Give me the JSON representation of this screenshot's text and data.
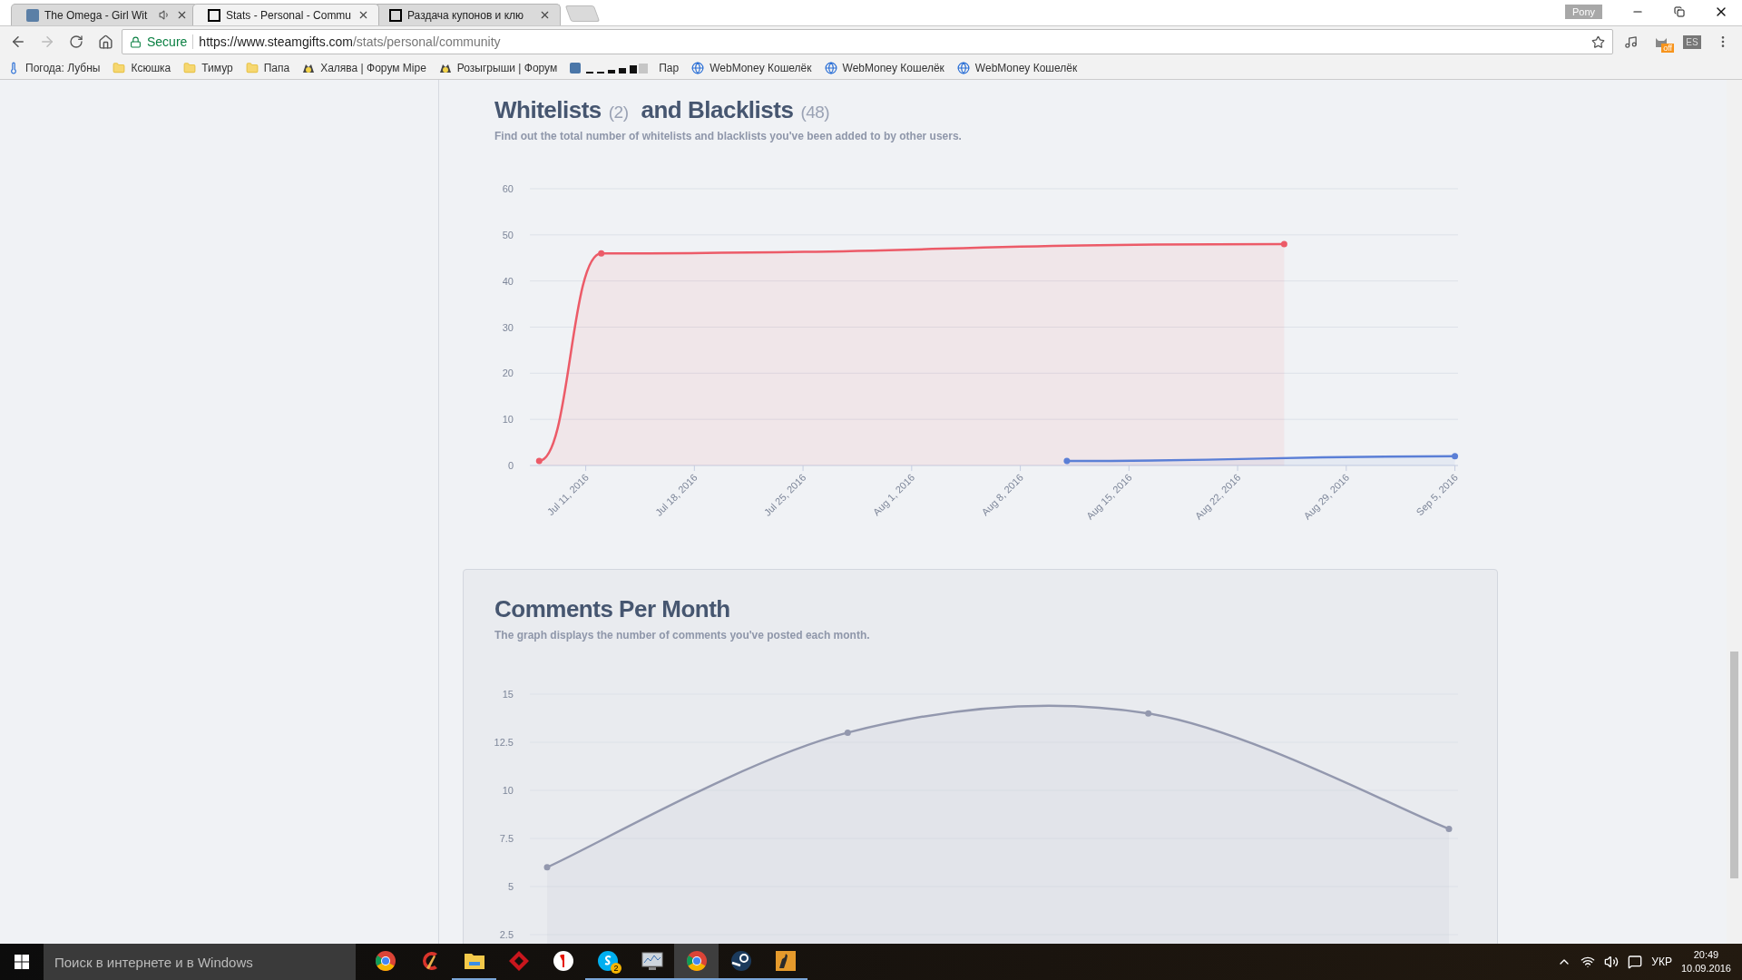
{
  "window": {
    "profile": "Pony"
  },
  "tabs": [
    {
      "title": "The Omega - Girl Wit",
      "selected": false,
      "audio": true
    },
    {
      "title": "Stats - Personal - Commu",
      "selected": true,
      "audio": false
    },
    {
      "title": "Раздача купонов и клю",
      "selected": false,
      "audio": false
    }
  ],
  "nav_buttons": [
    {
      "kind": "back",
      "disabled": false
    },
    {
      "kind": "forward",
      "disabled": true
    },
    {
      "kind": "reload",
      "disabled": false
    },
    {
      "kind": "home",
      "disabled": false
    }
  ],
  "address": {
    "secure_label": "Secure",
    "host": "https://www.steamgifts.com",
    "path": "/stats/personal/community"
  },
  "extensions": [
    {
      "kind": "clef"
    },
    {
      "kind": "cat",
      "badge": "off"
    },
    {
      "kind": "box",
      "label": "ES"
    }
  ],
  "bookmarks": [
    {
      "kind": "thermometer",
      "label": "Погода: Лубны"
    },
    {
      "kind": "folder",
      "label": "Ксюшка"
    },
    {
      "kind": "folder",
      "label": "Тимур"
    },
    {
      "kind": "folder",
      "label": "Папа"
    },
    {
      "kind": "mascot",
      "label": "Халява | Форум Mipe"
    },
    {
      "kind": "mascot",
      "label": "Розыгрыши | Форум"
    },
    {
      "kind": "vk",
      "label": "Пар"
    },
    {
      "kind": "globe",
      "label": "WebMoney Кошелёк"
    },
    {
      "kind": "globe",
      "label": "WebMoney Кошелёк"
    },
    {
      "kind": "globe",
      "label": "WebMoney Кошелёк"
    }
  ],
  "sections": [
    {
      "title": "Whitelists",
      "title_count": "(2)",
      "title_2": "and Blacklists",
      "title_2_count": "(48)",
      "boxed": false,
      "description": "Find out the total number of whitelists and blacklists you've been added to by other users.",
      "chart_data": {
        "type": "area",
        "grid": true,
        "ylim": [
          0,
          60
        ],
        "yticks": [
          0,
          10,
          20,
          30,
          40,
          50,
          60
        ],
        "categories": [
          null,
          null,
          null,
          "Jul 11, 2016",
          null,
          null,
          null,
          null,
          null,
          null,
          "Jul 18, 2016",
          null,
          null,
          null,
          null,
          null,
          null,
          "Jul 25, 2016",
          null,
          null,
          null,
          null,
          null,
          null,
          "Aug 1, 2016",
          null,
          null,
          null,
          null,
          null,
          null,
          "Aug 8, 2016",
          null,
          null,
          null,
          null,
          null,
          null,
          "Aug 15, 2016",
          null,
          null,
          null,
          null,
          null,
          null,
          "Aug 22, 2016",
          null,
          null,
          null,
          null,
          null,
          null,
          "Aug 29, 2016",
          null,
          null,
          null,
          null,
          null,
          null,
          "Sep 5, 2016"
        ],
        "series": [
          {
            "color": "#ec5b68",
            "values": [
              1,
              null,
              null,
              null,
              46,
              null,
              null,
              null,
              null,
              null,
              null,
              null,
              null,
              null,
              null,
              null,
              null,
              null,
              null,
              null,
              null,
              null,
              null,
              null,
              null,
              null,
              null,
              null,
              null,
              null,
              null,
              null,
              null,
              null,
              null,
              null,
              null,
              null,
              null,
              null,
              null,
              null,
              null,
              null,
              null,
              null,
              null,
              null,
              48,
              null,
              null,
              null,
              null,
              null,
              null,
              null,
              null,
              null,
              null,
              null
            ]
          },
          {
            "color": "#5b7fd6",
            "values": [
              null,
              null,
              null,
              null,
              null,
              null,
              null,
              null,
              null,
              null,
              null,
              null,
              null,
              null,
              null,
              null,
              null,
              null,
              null,
              null,
              null,
              null,
              null,
              null,
              null,
              null,
              null,
              null,
              null,
              null,
              null,
              null,
              null,
              null,
              1,
              null,
              null,
              null,
              null,
              null,
              null,
              null,
              null,
              null,
              null,
              null,
              null,
              null,
              null,
              null,
              null,
              null,
              null,
              null,
              null,
              null,
              null,
              null,
              null,
              2
            ]
          }
        ]
      }
    },
    {
      "title": "Comments Per Month",
      "boxed": true,
      "description": "The graph displays the number of comments you've posted each month.",
      "chart_data": {
        "type": "area",
        "grid": true,
        "ylim": [
          0,
          15
        ],
        "yticks": [
          {
            "value": 2.5,
            "label": "2.5"
          },
          {
            "value": 5,
            "label": "5"
          },
          {
            "value": 7.5,
            "label": "7.5"
          },
          {
            "value": 10,
            "label": "10"
          },
          {
            "value": 12.5,
            "label": "12.5"
          },
          {
            "value": 15,
            "label": "15"
          }
        ],
        "series": [
          {
            "color": "#9398ae",
            "values": [
              6,
              13,
              14,
              8
            ]
          }
        ]
      }
    }
  ],
  "taskbar": {
    "search_placeholder": "Поиск в интернете и в Windows",
    "apps": [
      {
        "kind": "chrome",
        "running": false,
        "active": false
      },
      {
        "kind": "ccleaner",
        "running": false,
        "active": false
      },
      {
        "kind": "explorer",
        "running": true,
        "active": false
      },
      {
        "kind": "red-app",
        "running": false,
        "active": false
      },
      {
        "kind": "yandex",
        "running": false,
        "active": false
      },
      {
        "kind": "skype",
        "running": true,
        "active": false,
        "badge": "2"
      },
      {
        "kind": "monitor",
        "running": true,
        "active": false
      },
      {
        "kind": "chrome",
        "running": true,
        "active": true
      },
      {
        "kind": "steam",
        "running": true,
        "active": false
      },
      {
        "kind": "game",
        "running": true,
        "active": false
      }
    ],
    "language": "УКР",
    "time": "20:49",
    "date": "10.09.2016"
  }
}
